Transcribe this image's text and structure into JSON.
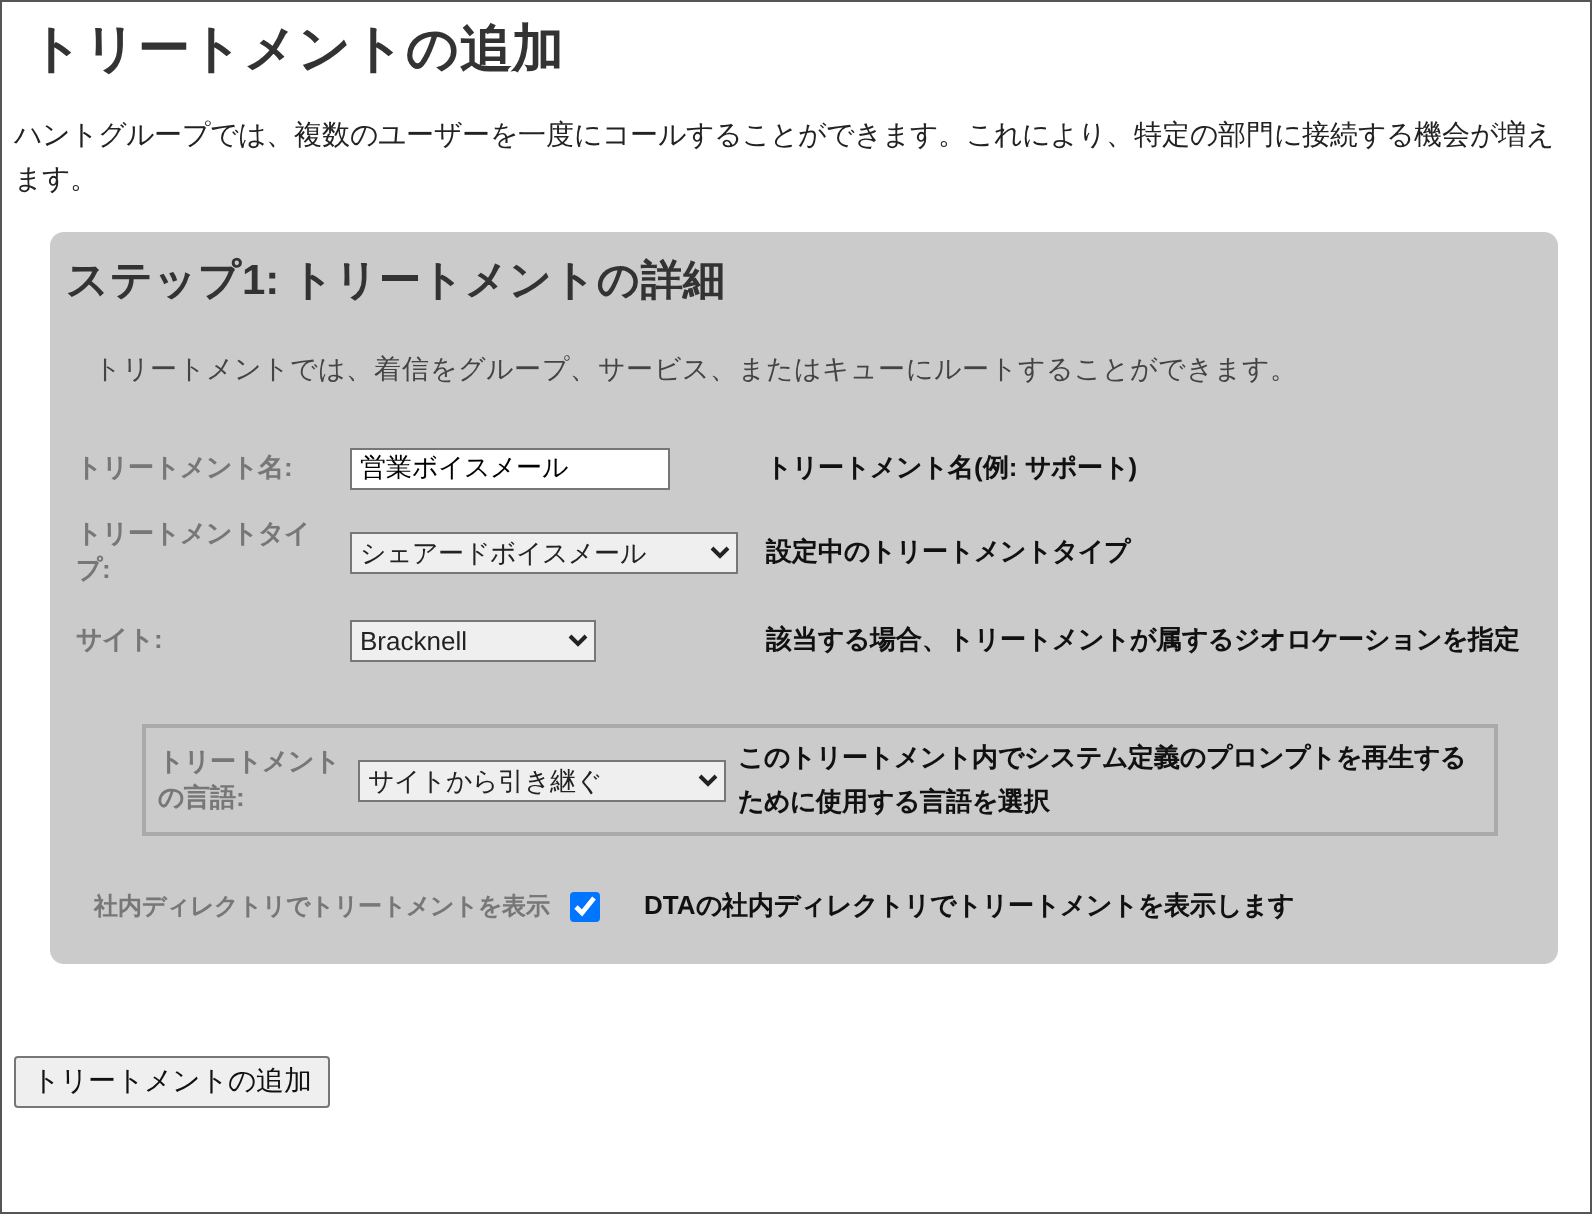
{
  "title": "トリートメントの追加",
  "intro": "ハントグループでは、複数のユーザーを一度にコールすることができます。これにより、特定の部門に接続する機会が増えます。",
  "step": {
    "heading": "ステップ1: トリートメントの詳細",
    "description": "トリートメントでは、着信をグループ、サービス、またはキューにルートすることができます。",
    "fields": [
      {
        "kind": "text",
        "label": "トリートメント名:",
        "value": "営業ボイスメール",
        "help": "トリートメント名(例: サポート)"
      },
      {
        "kind": "select",
        "label": "トリートメントタイプ:",
        "value": "シェアードボイスメール",
        "help": "設定中のトリートメントタイプ"
      },
      {
        "kind": "select",
        "label": "サイト:",
        "value": "Bracknell",
        "help": "該当する場合、トリートメントが属するジオロケーションを指定"
      }
    ],
    "language": {
      "label": "トリートメントの言語:",
      "value": "サイトから引き継ぐ",
      "help": "このトリートメント内でシステム定義のプロンプトを再生するために使用する言語を選択"
    },
    "directory": {
      "label": "社内ディレクトリでトリートメントを表示",
      "checked": true,
      "help": "DTAの社内ディレクトリでトリートメントを表示します"
    }
  },
  "submit": "トリートメントの追加"
}
